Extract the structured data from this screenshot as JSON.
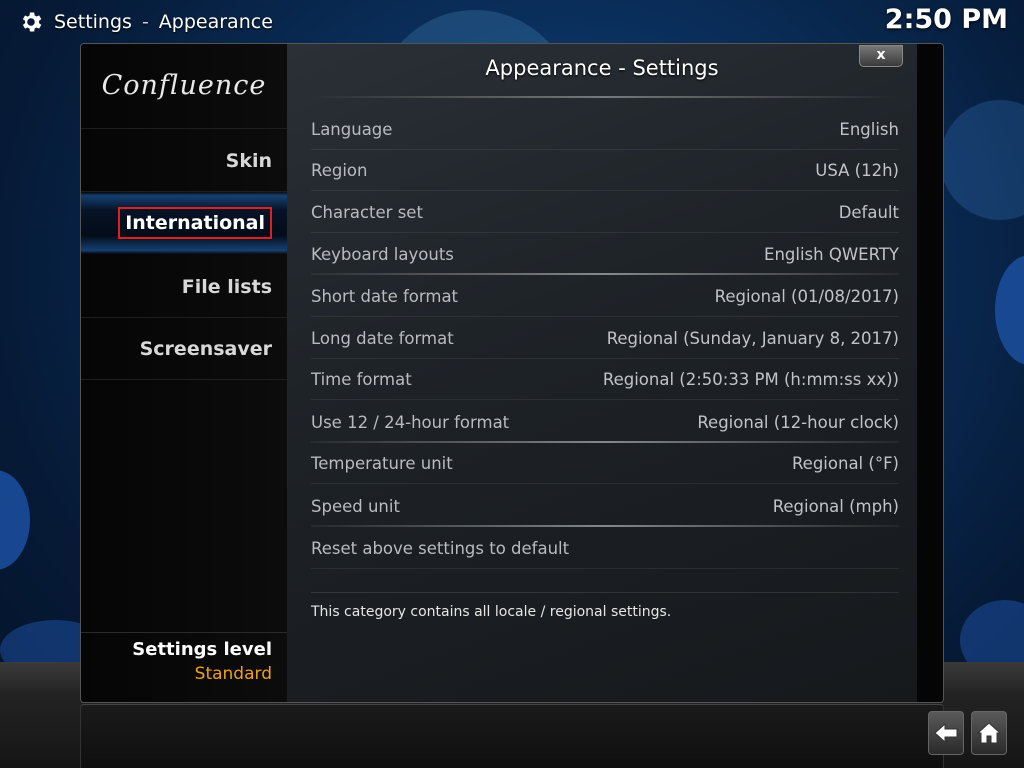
{
  "header": {
    "section": "Settings",
    "separator": "-",
    "page": "Appearance",
    "clock": "2:50 PM"
  },
  "dialog": {
    "title": "Appearance - Settings",
    "close_label": "x",
    "logo": "Confluence",
    "sidebar": {
      "items": [
        {
          "label": "Skin"
        },
        {
          "label": "International"
        },
        {
          "label": "File lists"
        },
        {
          "label": "Screensaver"
        }
      ],
      "active": "International",
      "settings_level_title": "Settings level",
      "settings_level_value": "Standard"
    },
    "settings": [
      {
        "label": "Language",
        "value": "English"
      },
      {
        "label": "Region",
        "value": "USA (12h)"
      },
      {
        "label": "Character set",
        "value": "Default"
      },
      {
        "label": "Keyboard layouts",
        "value": "English QWERTY"
      },
      {
        "label": "Short date format",
        "value": "Regional (01/08/2017)"
      },
      {
        "label": "Long date format",
        "value": "Regional (Sunday, January 8, 2017)"
      },
      {
        "label": "Time format",
        "value": "Regional (2:50:33 PM (h:mm:ss xx))"
      },
      {
        "label": "Use 12 / 24-hour format",
        "value": "Regional (12-hour clock)"
      },
      {
        "label": "Temperature unit",
        "value": "Regional (°F)"
      },
      {
        "label": "Speed unit",
        "value": "Regional (mph)"
      },
      {
        "label": "Reset above settings to default",
        "value": ""
      }
    ],
    "description": "This category contains all locale / regional settings."
  },
  "colors": {
    "accent_highlight": "#1e6ec8",
    "settings_level_value": "#f0a020",
    "focus_border": "#e02020"
  },
  "icons": {
    "header": "gear-icon",
    "back": "back-arrow-icon",
    "home": "home-icon"
  }
}
